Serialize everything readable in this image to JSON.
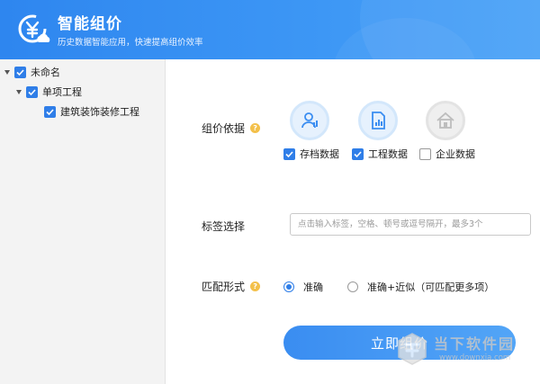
{
  "header": {
    "title": "智能组价",
    "subtitle": "历史数据智能应用，快速提高组价效率",
    "logo_icon": "yuan-cloud-icon"
  },
  "sidebar": {
    "tree": [
      {
        "label": "未命名",
        "checked": true,
        "expanded": true,
        "level": 0
      },
      {
        "label": "单项工程",
        "checked": true,
        "expanded": true,
        "level": 1
      },
      {
        "label": "建筑装饰装修工程",
        "checked": true,
        "level": 2
      }
    ]
  },
  "form": {
    "source": {
      "label": "组价依据",
      "options": [
        {
          "label": "存档数据",
          "checked": true,
          "icon": "user-archive-icon",
          "state": "active"
        },
        {
          "label": "工程数据",
          "checked": true,
          "icon": "document-chart-icon",
          "state": "active"
        },
        {
          "label": "企业数据",
          "checked": false,
          "icon": "building-icon",
          "state": "disabled"
        }
      ]
    },
    "tags": {
      "label": "标签选择",
      "placeholder": "点击输入标签，空格、顿号或逗号隔开，最多3个",
      "value": ""
    },
    "match": {
      "label": "匹配形式",
      "options": [
        {
          "label": "准确",
          "selected": true
        },
        {
          "label": "准确+近似（可匹配更多项）",
          "selected": false
        }
      ]
    },
    "submit_label": "立即组价"
  },
  "watermark": {
    "text": "当下软件园",
    "url": "www.downxia.com"
  },
  "colors": {
    "primary": "#2f7ee8",
    "header": "#3a8df1",
    "help": "#f3c04a"
  }
}
